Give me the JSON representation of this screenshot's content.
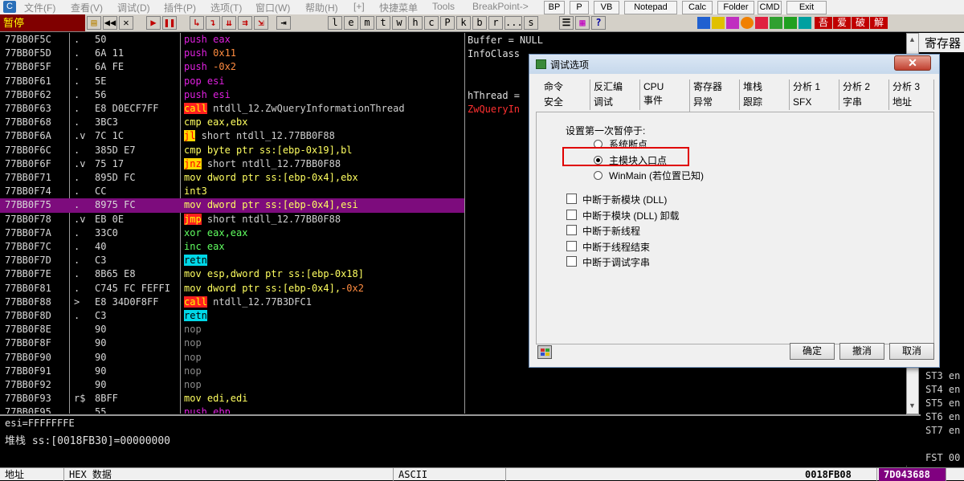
{
  "menubar": {
    "items": [
      "文件(F)",
      "查看(V)",
      "调试(D)",
      "插件(P)",
      "选项(T)",
      "窗口(W)",
      "帮助(H)",
      "[+]",
      "快捷菜单",
      "Tools",
      "BreakPoint->"
    ],
    "quick_buttons": [
      "BP",
      "P",
      "VB",
      "Notepad",
      "Calc",
      "Folder",
      "CMD",
      "Exit"
    ]
  },
  "toolbar": {
    "status": "暂停",
    "letter_buttons": [
      "l",
      "e",
      "m",
      "t",
      "w",
      "h",
      "c",
      "P",
      "k",
      "b",
      "r",
      "...",
      "s"
    ],
    "right_labels": [
      "吾",
      "爱",
      "破",
      "解"
    ]
  },
  "disasm": {
    "rows": [
      {
        "addr": "77BB0F5C",
        "ind": ".",
        "hex": "50",
        "asm": [
          {
            "t": "push eax",
            "c": "m"
          }
        ]
      },
      {
        "addr": "77BB0F5D",
        "ind": ".",
        "hex": "6A 11",
        "asm": [
          {
            "t": "push ",
            "c": "m"
          },
          {
            "t": "0x11",
            "c": "o"
          }
        ]
      },
      {
        "addr": "77BB0F5F",
        "ind": ".",
        "hex": "6A FE",
        "asm": [
          {
            "t": "push ",
            "c": "m"
          },
          {
            "t": "-0x2",
            "c": "o"
          }
        ]
      },
      {
        "addr": "77BB0F61",
        "ind": ".",
        "hex": "5E",
        "asm": [
          {
            "t": "pop esi",
            "c": "m"
          }
        ]
      },
      {
        "addr": "77BB0F62",
        "ind": ".",
        "hex": "56",
        "asm": [
          {
            "t": "push esi",
            "c": "m"
          }
        ]
      },
      {
        "addr": "77BB0F63",
        "ind": ".",
        "hex": "E8 D0ECF7FF",
        "asm": [
          {
            "t": "call",
            "c": "r"
          },
          {
            "t": " ntdll_12.ZwQueryInformationThread",
            "c": "w"
          }
        ]
      },
      {
        "addr": "77BB0F68",
        "ind": ".",
        "hex": "3BC3",
        "asm": [
          {
            "t": "cmp eax,ebx",
            "c": "y"
          }
        ]
      },
      {
        "addr": "77BB0F6A",
        "ind": ".v",
        "hex": "7C 1C",
        "asm": [
          {
            "t": "jl",
            "c": "ry"
          },
          {
            "t": " short ntdll_12.77BB0F88",
            "c": "w"
          }
        ]
      },
      {
        "addr": "77BB0F6C",
        "ind": ".",
        "hex": "385D E7",
        "asm": [
          {
            "t": "cmp byte ptr ss:[ebp-0x19],bl",
            "c": "y"
          }
        ]
      },
      {
        "addr": "77BB0F6F",
        "ind": ".v",
        "hex": "75 17",
        "asm": [
          {
            "t": "jnz",
            "c": "ry"
          },
          {
            "t": " short ntdll_12.77BB0F88",
            "c": "w"
          }
        ]
      },
      {
        "addr": "77BB0F71",
        "ind": ".",
        "hex": "895D FC",
        "asm": [
          {
            "t": "mov dword ptr ss:[ebp-0x4],ebx",
            "c": "y"
          }
        ]
      },
      {
        "addr": "77BB0F74",
        "ind": ".",
        "hex": "CC",
        "asm": [
          {
            "t": "int3",
            "c": "y"
          }
        ]
      },
      {
        "addr": "77BB0F75",
        "ind": ".",
        "hex": "8975 FC",
        "asm": [
          {
            "t": "mov dword ptr ss:[ebp-0x4],esi",
            "c": "y"
          }
        ],
        "sel": true
      },
      {
        "addr": "77BB0F78",
        "ind": ".v",
        "hex": "EB 0E",
        "asm": [
          {
            "t": "jmp",
            "c": "r"
          },
          {
            "t": " short ntdll_12.77BB0F88",
            "c": "w"
          }
        ]
      },
      {
        "addr": "77BB0F7A",
        "ind": ".",
        "hex": "33C0",
        "asm": [
          {
            "t": "xor eax,eax",
            "c": "g"
          }
        ]
      },
      {
        "addr": "77BB0F7C",
        "ind": ".",
        "hex": "40",
        "asm": [
          {
            "t": "inc eax",
            "c": "g"
          }
        ]
      },
      {
        "addr": "77BB0F7D",
        "ind": ".",
        "hex": "C3",
        "asm": [
          {
            "t": "retn",
            "c": "cb"
          }
        ]
      },
      {
        "addr": "77BB0F7E",
        "ind": ".",
        "hex": "8B65 E8",
        "asm": [
          {
            "t": "mov esp,dword ptr ss:[ebp-0x18]",
            "c": "y"
          }
        ]
      },
      {
        "addr": "77BB0F81",
        "ind": ".",
        "hex": "C745 FC FEFFI",
        "asm": [
          {
            "t": "mov dword ptr ss:[ebp-0x4],",
            "c": "y"
          },
          {
            "t": "-0x2",
            "c": "o"
          }
        ]
      },
      {
        "addr": "77BB0F88",
        "ind": ">",
        "hex": "E8 34D0F8FF",
        "asm": [
          {
            "t": "call",
            "c": "r"
          },
          {
            "t": " ntdll_12.77B3DFC1",
            "c": "w"
          }
        ]
      },
      {
        "addr": "77BB0F8D",
        "ind": ".",
        "hex": "C3",
        "asm": [
          {
            "t": "retn",
            "c": "cb"
          }
        ]
      },
      {
        "addr": "77BB0F8E",
        "ind": "",
        "hex": "90",
        "asm": [
          {
            "t": "nop",
            "c": "gr"
          }
        ]
      },
      {
        "addr": "77BB0F8F",
        "ind": "",
        "hex": "90",
        "asm": [
          {
            "t": "nop",
            "c": "gr"
          }
        ]
      },
      {
        "addr": "77BB0F90",
        "ind": "",
        "hex": "90",
        "asm": [
          {
            "t": "nop",
            "c": "gr"
          }
        ]
      },
      {
        "addr": "77BB0F91",
        "ind": "",
        "hex": "90",
        "asm": [
          {
            "t": "nop",
            "c": "gr"
          }
        ]
      },
      {
        "addr": "77BB0F92",
        "ind": "",
        "hex": "90",
        "asm": [
          {
            "t": "nop",
            "c": "gr"
          }
        ]
      },
      {
        "addr": "77BB0F93",
        "ind": "r$",
        "hex": "8BFF",
        "asm": [
          {
            "t": "mov edi,edi",
            "c": "y"
          }
        ]
      },
      {
        "addr": "77BB0F95",
        "ind": "",
        "hex": "55",
        "asm": [
          {
            "t": "push ebp",
            "c": "m"
          }
        ]
      }
    ],
    "comments": [
      {
        "t": "Buffer = NULL",
        "red": false
      },
      {
        "t": "InfoClass",
        "red": false
      },
      {
        "t": "hThread =",
        "red": false
      },
      {
        "t": "ZwQueryIn",
        "red": true
      }
    ]
  },
  "registers": {
    "header": "寄存器",
    "labels": [
      "ST3 en",
      "ST4 en",
      "ST5 en",
      "ST6 en",
      "ST7 en",
      "FST 00"
    ]
  },
  "info": {
    "line1": "esi=FFFFFFFE",
    "line2": "堆栈 ss:[0018FB30]=00000000"
  },
  "statusbar": {
    "addr_col": "地址",
    "hex_col": "HEX 数据",
    "ascii_col": "ASCII",
    "stack_addr": "0018FB08",
    "stack_val": "7D043688"
  },
  "dialog": {
    "title": "调试选项",
    "tabs_row1": [
      "命令",
      "反汇编",
      "CPU",
      "寄存器",
      "堆栈",
      "分析 1",
      "分析 2",
      "分析 3"
    ],
    "tabs_row2": [
      "安全",
      "调试",
      "事件",
      "异常",
      "跟踪",
      "SFX",
      "字串",
      "地址"
    ],
    "active_tab": "事件",
    "group_label": "设置第一次暂停于:",
    "radios": [
      "系统断点",
      "主模块入口点",
      "WinMain (若位置已知)"
    ],
    "checkboxes": [
      "中断于新模块 (DLL)",
      "中断于模块 (DLL) 卸载",
      "中断于新线程",
      "中断于线程结束",
      "中断于调试字串"
    ],
    "ok": "确定",
    "undo": "撤消",
    "cancel": "取消"
  }
}
